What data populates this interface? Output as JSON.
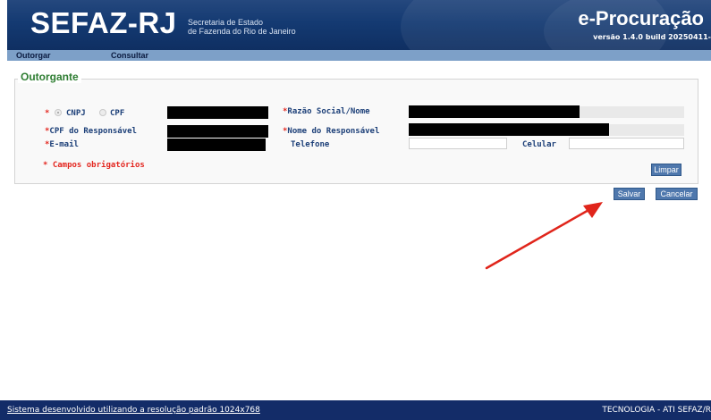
{
  "header": {
    "brand": "SEFAZ-RJ",
    "subtitle_line1": "Secretaria de Estado",
    "subtitle_line2": "de Fazenda do Rio de Janeiro",
    "app_title": "e-Procuração",
    "version": "versão 1.4.0 build 20250411-"
  },
  "nav": {
    "items": [
      {
        "label": "Outorgar"
      },
      {
        "label": "Consultar"
      }
    ]
  },
  "form": {
    "legend": "Outorgante",
    "required_mark": "*",
    "radio_cnpj": "CNPJ",
    "radio_cpf": "CPF",
    "selected_type": "CNPJ",
    "razao_label": "Razão Social/Nome",
    "cpf_resp_label": "CPF do Responsável",
    "nome_resp_label": "Nome do Responsável",
    "email_label": "E-mail",
    "telefone_label": "Telefone",
    "celular_label": "Celular",
    "required_note": "* Campos obrigatórios"
  },
  "buttons": {
    "limpar": "Limpar",
    "salvar": "Salvar",
    "cancelar": "Cancelar"
  },
  "footer": {
    "left": "Sistema desenvolvido utilizando a resolução padrão 1024x768",
    "right": "TECNOLOGIA - ATI SEFAZ/R"
  },
  "colors": {
    "header_bg": "#143a72",
    "nav_bg": "#7da0c8",
    "label_blue": "#1c3f78",
    "required_red": "#e3261f",
    "legend_green": "#2e7d32",
    "button_bg": "#4f78ad",
    "footer_bg": "#132c68",
    "annotation_arrow": "#e0251b"
  },
  "icons": {
    "annotation": "red-arrow-pointing-to-salvar"
  }
}
